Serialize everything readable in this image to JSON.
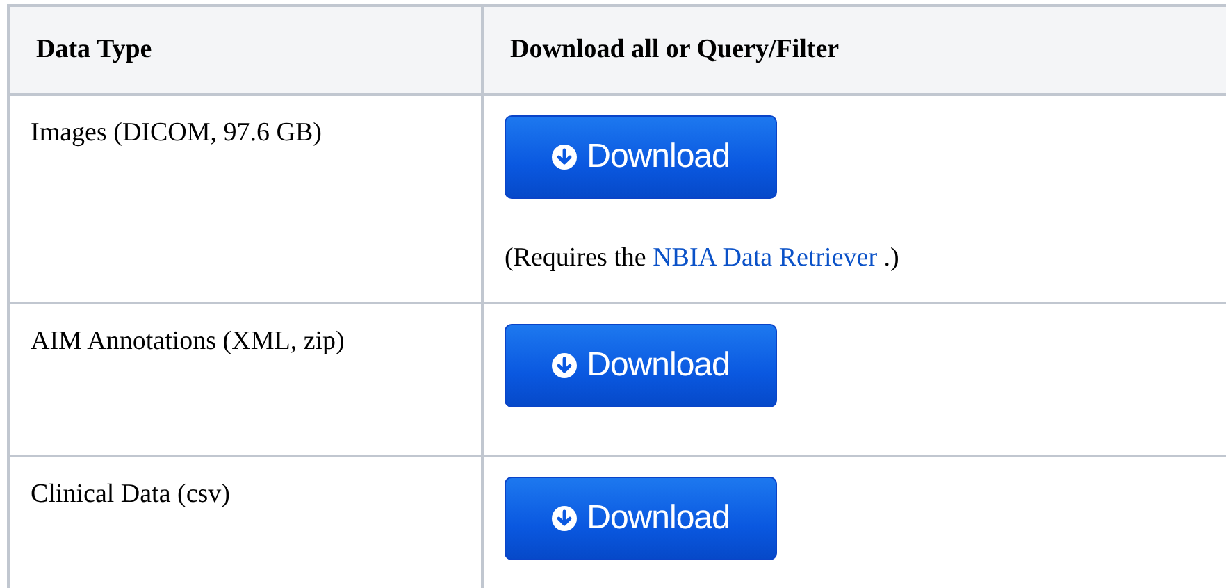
{
  "table": {
    "columns": [
      "Data Type",
      "Download all or Query/Filter"
    ],
    "rows": [
      {
        "data_type": "Images (DICOM, 97.6 GB)",
        "button": "Download",
        "note": {
          "before": "(Requires the ",
          "link": "NBIA Data Retriever",
          "after": " .)"
        }
      },
      {
        "data_type": "AIM Annotations (XML, zip)",
        "button": "Download"
      },
      {
        "data_type": "Clinical Data (csv)",
        "button": "Download"
      }
    ]
  }
}
